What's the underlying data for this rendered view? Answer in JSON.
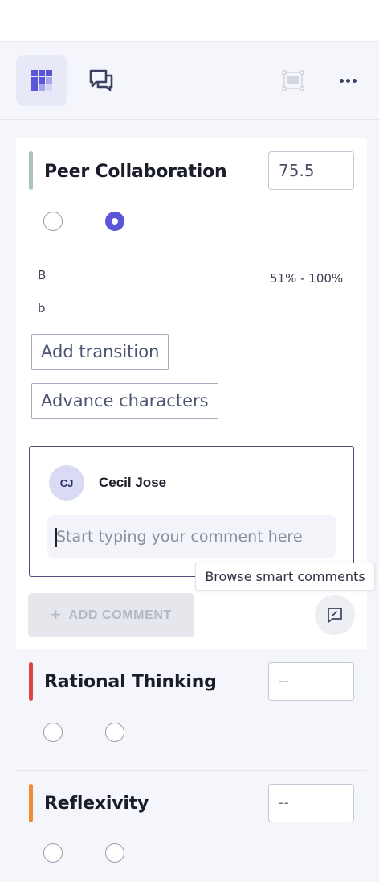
{
  "toolbar": {
    "grid_icon": "grid-view-icon",
    "chat_icon": "comments-icon",
    "frame_icon": "focus-frame-icon",
    "more_icon": "more-options-icon"
  },
  "criteria": [
    {
      "title": "Peer Collaboration",
      "score": "75.5",
      "bar_color": "#a9c4be",
      "selected_option": 2,
      "levels": [
        {
          "label": "B",
          "range": "51% - 100%"
        },
        {
          "label": "b"
        }
      ],
      "chips": [
        "Add transition",
        "Advance characters"
      ]
    },
    {
      "title": "Rational Thinking",
      "score": "--",
      "bar_color": "#e0463d"
    },
    {
      "title": "Reflexivity",
      "score": "--",
      "bar_color": "#ef8a35"
    }
  ],
  "comment": {
    "avatar_initials": "CJ",
    "author": "Cecil Jose",
    "placeholder": "Start typing your comment here",
    "add_label": "ADD COMMENT",
    "add_icon": "+",
    "tooltip": "Browse smart comments"
  },
  "colors": {
    "accent": "#5b55d8",
    "grid_cells": [
      "#5b55d8",
      "#5b55d8",
      "#5b55d8",
      "#5b55d8",
      "#5b55d8",
      "#a7a4ec",
      "#5b55d8",
      "#a7a4ec",
      "#d6d4f6"
    ]
  }
}
